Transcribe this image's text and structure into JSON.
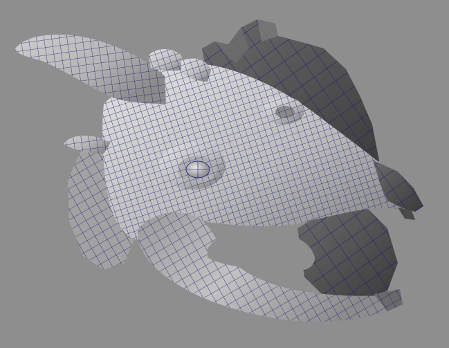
{
  "viewport": {
    "background_color": "#8e8e8e",
    "wireframe_color": "#1a1a7a",
    "lit_surface_color": "#c9c9c9",
    "shadow_surface_color": "#5c5c5c",
    "dark_surface_color": "#3a3a3a"
  },
  "model": {
    "parts": [
      "horn",
      "brow-ridge",
      "back-crest-spikes",
      "head-shell",
      "eye-socket",
      "eye",
      "snout",
      "jaw",
      "mouth-opening",
      "cheek-spike"
    ]
  }
}
